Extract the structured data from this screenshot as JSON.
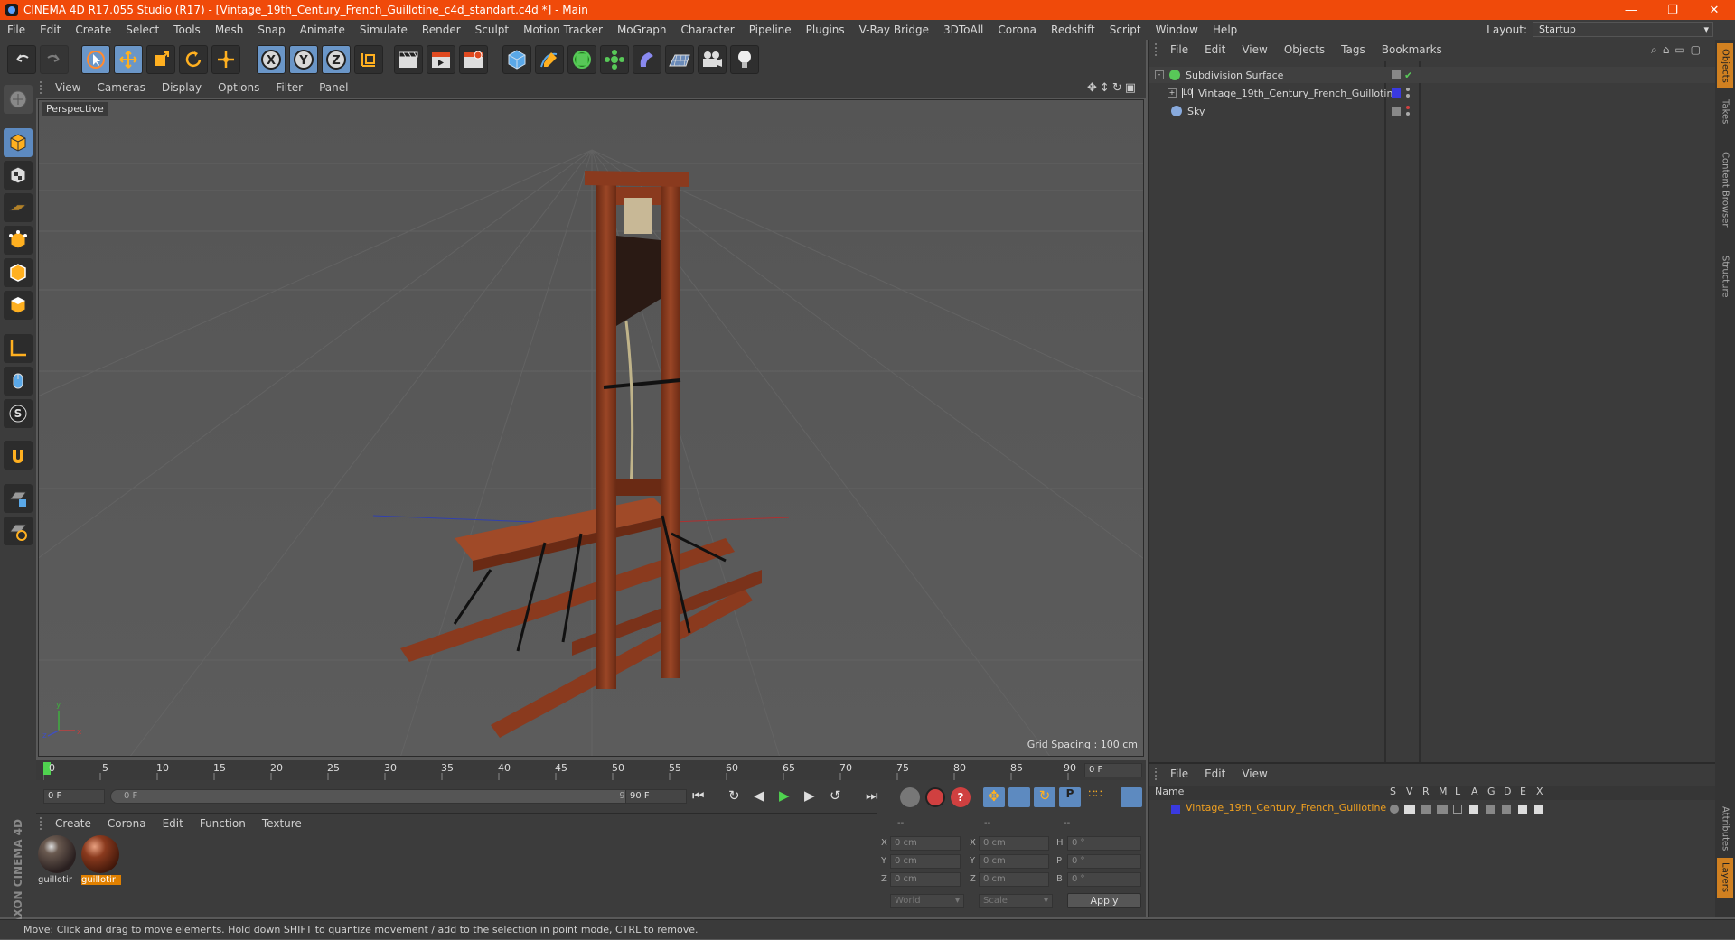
{
  "title": "CINEMA 4D R17.055 Studio (R17) - [Vintage_19th_Century_French_Guillotine_c4d_standart.c4d *] - Main",
  "menu": [
    "File",
    "Edit",
    "Create",
    "Select",
    "Tools",
    "Mesh",
    "Snap",
    "Animate",
    "Simulate",
    "Render",
    "Sculpt",
    "Motion Tracker",
    "MoGraph",
    "Character",
    "Pipeline",
    "Plugins",
    "V-Ray Bridge",
    "3DToAll",
    "Corona",
    "Redshift",
    "Script",
    "Window",
    "Help"
  ],
  "layout_label": "Layout:",
  "layout_value": "Startup",
  "viewport_menu": [
    "View",
    "Cameras",
    "Display",
    "Options",
    "Filter",
    "Panel"
  ],
  "viewport_label": "Perspective",
  "grid_spacing": "Grid Spacing : 100 cm",
  "object_menu": [
    "File",
    "Edit",
    "View",
    "Objects",
    "Tags",
    "Bookmarks"
  ],
  "objects": [
    {
      "name": "Subdivision Surface",
      "icon": "subdivision-icon",
      "color": "#58c858"
    },
    {
      "name": "Vintage_19th_Century_French_Guillotine",
      "icon": "null-object-icon",
      "color": "#dddddd"
    },
    {
      "name": "Sky",
      "icon": "sky-icon",
      "color": "#88aadd"
    }
  ],
  "layer_menu": [
    "File",
    "Edit",
    "View"
  ],
  "layer_headers": [
    "Name",
    "S",
    "V",
    "R",
    "M",
    "L",
    "A",
    "G",
    "D",
    "E",
    "X"
  ],
  "layer_row": "Vintage_19th_Century_French_Guillotine",
  "timeline_ticks": [
    "0",
    "5",
    "10",
    "15",
    "20",
    "25",
    "30",
    "35",
    "40",
    "45",
    "50",
    "55",
    "60",
    "65",
    "70",
    "75",
    "80",
    "85",
    "90"
  ],
  "frame_field": "0 F",
  "range_start": "0 F",
  "range_slider_start": "0 F",
  "range_slider_end": "90 F",
  "range_end": "90 F",
  "material_menu": [
    "Create",
    "Corona",
    "Edit",
    "Function",
    "Texture"
  ],
  "materials": [
    "guillotir",
    "guillotir"
  ],
  "coords": {
    "header": [
      "--",
      "--",
      "--"
    ],
    "rows": [
      {
        "a": "X",
        "av": "0 cm",
        "b": "X",
        "bv": "0 cm",
        "c": "H",
        "cv": "0 °"
      },
      {
        "a": "Y",
        "av": "0 cm",
        "b": "Y",
        "bv": "0 cm",
        "c": "P",
        "cv": "0 °"
      },
      {
        "a": "Z",
        "av": "0 cm",
        "b": "Z",
        "bv": "0 cm",
        "c": "B",
        "cv": "0 °"
      }
    ],
    "world": "World",
    "scale": "Scale",
    "apply": "Apply"
  },
  "right_tabs": [
    "Objects",
    "Takes",
    "Content Browser",
    "Structure"
  ],
  "right_tabs_bottom": [
    "Attributes",
    "Layers"
  ],
  "status": "Move: Click and drag to move elements. Hold down SHIFT to quantize movement / add to the selection in point mode, CTRL to remove.",
  "maxon_logo": "MAXON CINEMA 4D"
}
